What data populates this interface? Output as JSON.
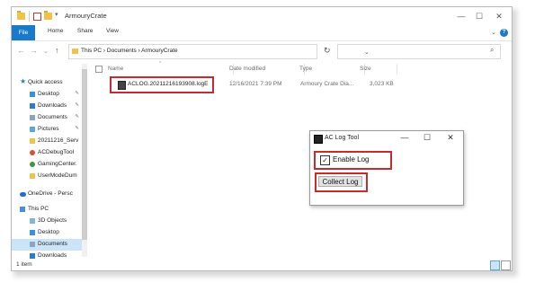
{
  "window": {
    "title": "ArmouryCrate",
    "controls": {
      "minimize": "—",
      "maximize": "☐",
      "close": "✕"
    }
  },
  "ribbon": {
    "tabs": [
      "File",
      "Home",
      "Share",
      "View"
    ],
    "collapse_glyph": "⌄",
    "help_glyph": "?"
  },
  "address": {
    "back": "←",
    "forward": "→",
    "recent": "⌄",
    "up": "↑",
    "path": "This PC  ›  Documents  ›  ArmouryCrate",
    "dropdown": "⌄",
    "refresh": "↻",
    "search_placeholder": "",
    "search_icon": "⌕"
  },
  "sidebar": {
    "items": [
      {
        "label": "Quick access",
        "icon": "star-icon",
        "color": "#2b7bd6",
        "pinned": false
      },
      {
        "label": "Desktop",
        "icon": "desktop-icon",
        "color": "#3b8ee6",
        "pinned": true
      },
      {
        "label": "Downloads",
        "icon": "download-icon",
        "color": "#2b7bd6",
        "pinned": true
      },
      {
        "label": "Documents",
        "icon": "documents-icon",
        "color": "#8aa4c4",
        "pinned": true
      },
      {
        "label": "Pictures",
        "icon": "pictures-icon",
        "color": "#5ba4e6",
        "pinned": true
      },
      {
        "label": "20211216_Serv",
        "icon": "folder-icon",
        "color": "#f0c24a",
        "pinned": false
      },
      {
        "label": "ACDebugTool",
        "icon": "app-icon",
        "color": "#d9532a",
        "pinned": false
      },
      {
        "label": "GamingCenter.",
        "icon": "app-icon",
        "color": "#3c9a3c",
        "pinned": false
      },
      {
        "label": "UserModeDum",
        "icon": "folder-icon",
        "color": "#f0c24a",
        "pinned": false
      },
      {
        "label": "OneDrive - Persc",
        "icon": "onedrive-icon",
        "color": "#1e6fd0",
        "pinned": false
      },
      {
        "label": "This PC",
        "icon": "pc-icon",
        "color": "#4a90d9",
        "pinned": false
      },
      {
        "label": "3D Objects",
        "icon": "3d-objects-icon",
        "color": "#7fb4e8",
        "pinned": false
      },
      {
        "label": "Desktop",
        "icon": "desktop-icon",
        "color": "#3b8ee6",
        "pinned": false
      },
      {
        "label": "Documents",
        "icon": "documents-icon",
        "color": "#8aa4c4",
        "pinned": false,
        "active": true
      },
      {
        "label": "Downloads",
        "icon": "download-icon",
        "color": "#2b7bd6",
        "pinned": false
      }
    ],
    "pin_glyph": "📌"
  },
  "content": {
    "sort_arrow": "^",
    "columns": [
      "Name",
      "Date modified",
      "Type",
      "Size"
    ],
    "rows": [
      {
        "name": "ACLOG.20211216193908.logE",
        "date": "12/16/2021 7:39 PM",
        "type": "Armoury Crate Dia...",
        "size": "3,023 KB"
      }
    ]
  },
  "status": {
    "count": "1 item"
  },
  "dialog": {
    "title": "AC Log Tool",
    "controls": {
      "minimize": "—",
      "maximize": "☐",
      "close": "✕"
    },
    "enable_log_label": "Enable Log",
    "enable_log_checked": true,
    "check_glyph": "✓",
    "collect_button": "Collect Log"
  },
  "colors": {
    "accent": "#1979ca",
    "highlight_outline": "#c72b2b",
    "selected_bg": "#cce4f7"
  }
}
